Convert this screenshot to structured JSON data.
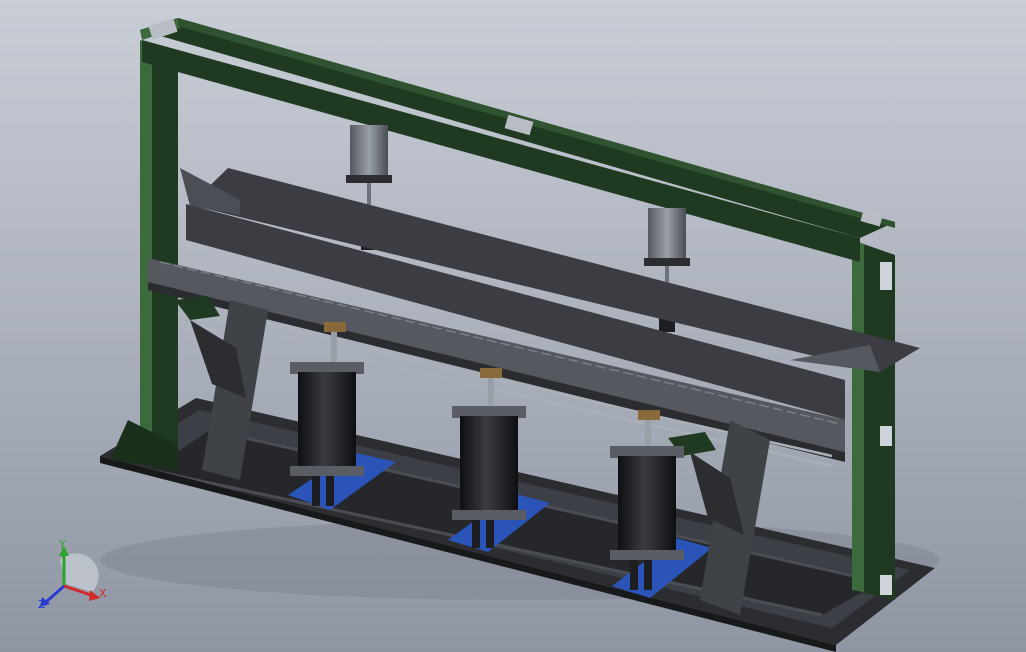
{
  "viewport": {
    "background_top": "#c9cdd6",
    "background_bottom": "#8f96a3"
  },
  "model": {
    "frame_color": "#1f3a20",
    "frame_highlight": "#3c6a3c",
    "base_color": "#2b2d31",
    "press_color": "#3b3d42",
    "cylinder_color": "#1c1d20",
    "plate_color": "#2a54b8",
    "accent_color": "#8a6a3a"
  },
  "triad": {
    "x_label": "X",
    "y_label": "Y",
    "z_label": "Z",
    "x_color": "#d12b2b",
    "y_color": "#2aa52a",
    "z_color": "#2b3bd1"
  }
}
